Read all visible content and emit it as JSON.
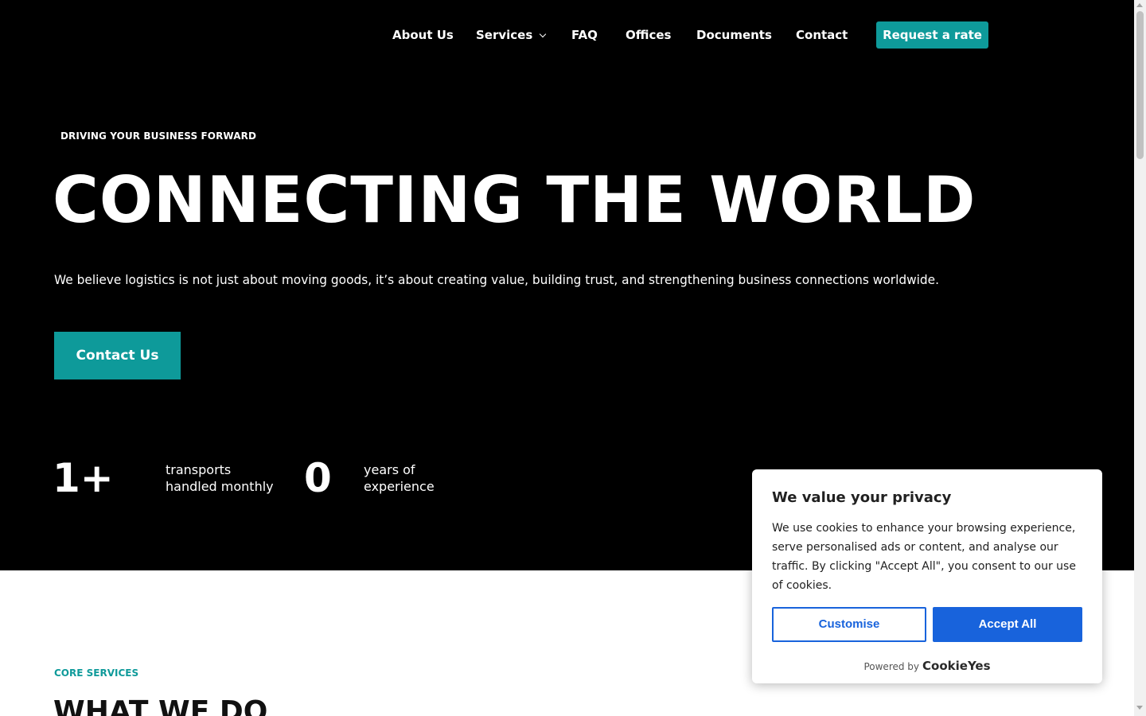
{
  "nav": {
    "items": [
      {
        "label": "About Us"
      },
      {
        "label": "Services"
      },
      {
        "label": "FAQ"
      },
      {
        "label": "Offices"
      },
      {
        "label": "Documents"
      },
      {
        "label": "Contact"
      }
    ],
    "cta_label": "Request a rate"
  },
  "hero": {
    "eyebrow": "DRIVING YOUR BUSINESS FORWARD",
    "title": "CONNECTING THE WORLD",
    "lead": "We believe logistics is not just about moving goods, it’s about creating value, building trust, and strengthening business connections worldwide.",
    "cta_label": "Contact Us",
    "stats": [
      {
        "value": "1+",
        "label": "transports handled monthly"
      },
      {
        "value": "0",
        "label": "years of experience"
      }
    ]
  },
  "services": {
    "eyebrow": "CORE SERVICES",
    "title": "WHAT WE DO"
  },
  "cookie_banner": {
    "title": "We value your privacy",
    "text": "We use cookies to enhance your browsing experience, serve personalised ads or content, and analyse our traffic. By clicking \"Accept All\", you consent to our use of cookies.",
    "customise_label": "Customise",
    "accept_label": "Accept All",
    "powered_by": "Powered by",
    "brand": "CookieYes"
  },
  "colors": {
    "accent": "#0e9a9a",
    "hero_background": "#000000",
    "cookie_primary": "#1863dc"
  },
  "icons": {
    "services_dropdown": "chevron-down-icon"
  }
}
